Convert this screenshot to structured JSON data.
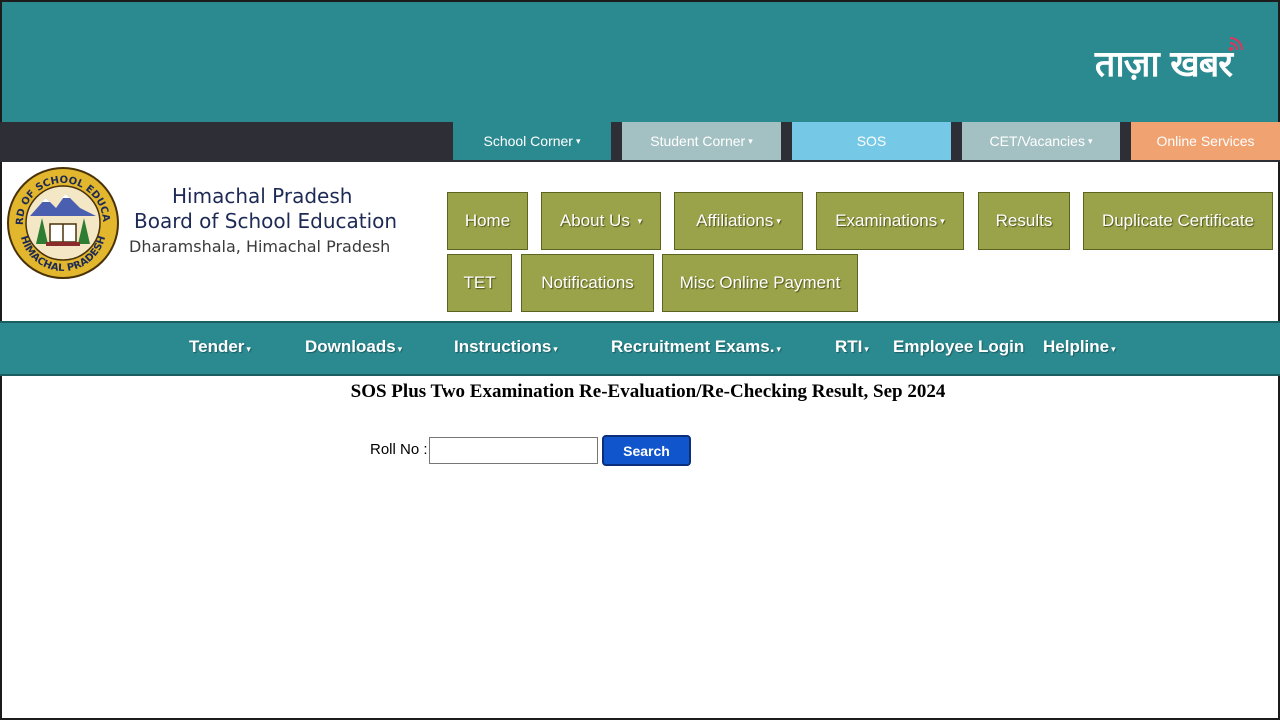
{
  "brand": {
    "text": "ताज़ा खबर"
  },
  "corner_tabs": [
    {
      "label": "School Corner",
      "caret": true,
      "bg": "#2a8a90"
    },
    {
      "label": "Student Corner",
      "caret": true,
      "bg": "#a3c1c3"
    },
    {
      "label": "SOS",
      "caret": false,
      "bg": "#76c9e6"
    },
    {
      "label": "CET/Vacancies",
      "caret": true,
      "bg": "#a3c1c3"
    },
    {
      "label": "Online Services",
      "caret": false,
      "bg": "#f0a270"
    }
  ],
  "org": {
    "line1": "Himachal Pradesh",
    "line2": "Board of School Education",
    "line3": "Dharamshala, Himachal Pradesh",
    "seal_text_top": "BOARD OF SCHOOL EDUCATION",
    "seal_text_bottom": "HIMACHAL PRADESH"
  },
  "main_nav": [
    {
      "label": "Home",
      "caret": false
    },
    {
      "label": "About Us",
      "caret": true
    },
    {
      "label": "Affiliations",
      "caret": true
    },
    {
      "label": "Examinations",
      "caret": true
    },
    {
      "label": "Results",
      "caret": false
    },
    {
      "label": "Duplicate Certificate",
      "caret": false
    },
    {
      "label": "TET",
      "caret": false
    },
    {
      "label": "Notifications",
      "caret": false
    },
    {
      "label": "Misc Online Payment",
      "caret": false
    }
  ],
  "sub_nav": [
    {
      "label": "Tender",
      "caret": true
    },
    {
      "label": "Downloads",
      "caret": true
    },
    {
      "label": "Instructions",
      "caret": true
    },
    {
      "label": "Recruitment Exams.",
      "caret": true
    },
    {
      "label": "RTI",
      "caret": true
    },
    {
      "label": "Employee Login",
      "caret": false
    },
    {
      "label": "Helpline",
      "caret": true
    }
  ],
  "page_title": "SOS Plus Two Examination Re-Evaluation/Re-Checking Result, Sep 2024",
  "form": {
    "roll_label": "Roll No :",
    "roll_value": "",
    "search_label": "Search"
  },
  "caret_glyph": "▾"
}
